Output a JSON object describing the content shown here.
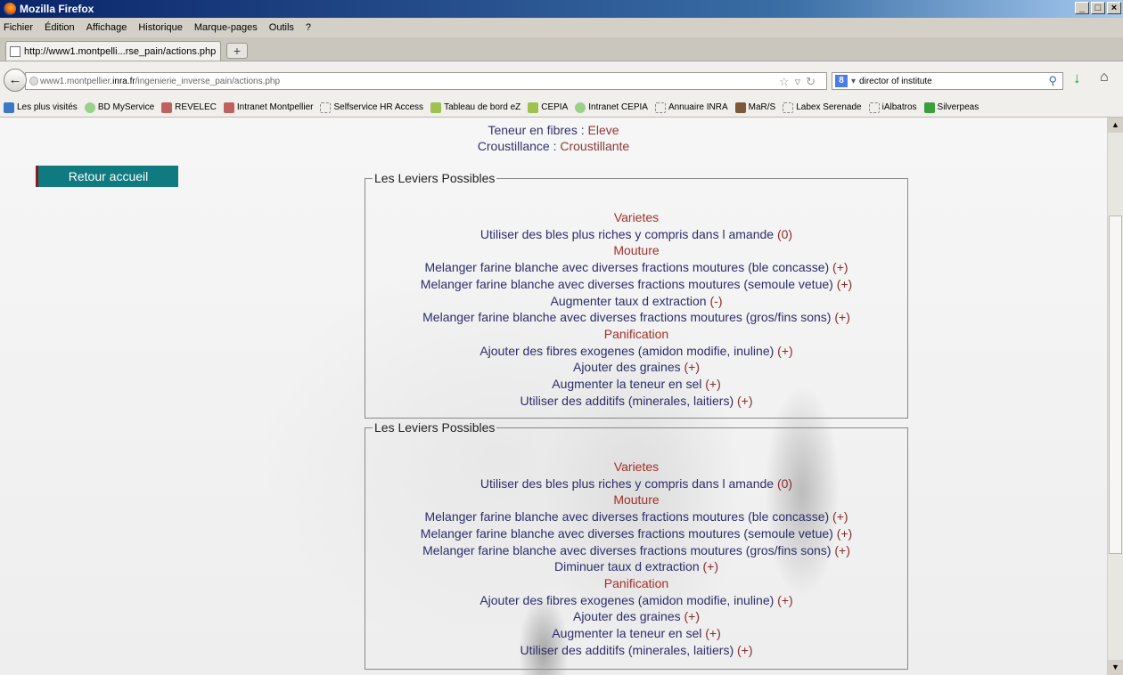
{
  "window": {
    "title": "Mozilla Firefox"
  },
  "menu": [
    "Fichier",
    "Édition",
    "Affichage",
    "Historique",
    "Marque-pages",
    "Outils",
    "?"
  ],
  "tab": {
    "label": "http://www1.montpelli...rse_pain/actions.php",
    "new_tab": "+"
  },
  "nav": {
    "url_pre": "www1.montpellier.",
    "url_domain": "inra.fr",
    "url_post": "/ingenierie_inverse_pain/actions.php",
    "search_value": "director of institute",
    "search_engine": "8"
  },
  "bookmarks": [
    "Les plus visités",
    "BD MyService",
    "REVELEC",
    "Intranet Montpellier",
    "Selfservice HR Access",
    "Tableau de bord eZ",
    "CEPIA",
    "Intranet CEPIA",
    "Annuaire INRA",
    "MaR/S",
    "Labex Serenade",
    "iAlbatros",
    "Silverpeas"
  ],
  "page": {
    "fibres_label": "Teneur en fibres : ",
    "fibres_value": "Eleve",
    "crous_label": "Croustillance : ",
    "crous_value": "Croustillante",
    "retour": "Retour accueil",
    "legend": "Les Leviers Possibles"
  },
  "boxes": [
    [
      {
        "t": "cat",
        "text": "Varietes"
      },
      {
        "t": "act",
        "text": "Utiliser des bles plus riches y compris dans l amande",
        "sign": "(0)"
      },
      {
        "t": "cat",
        "text": "Mouture"
      },
      {
        "t": "act",
        "text": "Melanger farine blanche avec diverses fractions moutures (ble concasse)",
        "sign": "(+)"
      },
      {
        "t": "act",
        "text": "Melanger farine blanche avec diverses fractions moutures (semoule vetue)",
        "sign": "(+)"
      },
      {
        "t": "act",
        "text": "Augmenter taux d extraction",
        "sign": "(-)"
      },
      {
        "t": "act",
        "text": "Melanger farine blanche avec diverses fractions moutures (gros/fins sons)",
        "sign": "(+)"
      },
      {
        "t": "cat",
        "text": "Panification"
      },
      {
        "t": "act",
        "text": "Ajouter des fibres exogenes (amidon modifie, inuline)",
        "sign": "(+)"
      },
      {
        "t": "act",
        "text": "Ajouter des graines",
        "sign": "(+)"
      },
      {
        "t": "act",
        "text": "Augmenter la teneur en sel",
        "sign": "(+)"
      },
      {
        "t": "act",
        "text": "Utiliser des additifs (minerales, laitiers)",
        "sign": "(+)"
      }
    ],
    [
      {
        "t": "cat",
        "text": "Varietes"
      },
      {
        "t": "act",
        "text": "Utiliser des bles plus riches y compris dans l amande",
        "sign": "(0)"
      },
      {
        "t": "cat",
        "text": "Mouture"
      },
      {
        "t": "act",
        "text": "Melanger farine blanche avec diverses fractions moutures (ble concasse)",
        "sign": "(+)"
      },
      {
        "t": "act",
        "text": "Melanger farine blanche avec diverses fractions moutures (semoule vetue)",
        "sign": "(+)"
      },
      {
        "t": "act",
        "text": "Melanger farine blanche avec diverses fractions moutures (gros/fins sons)",
        "sign": "(+)"
      },
      {
        "t": "act",
        "text": "Diminuer taux d extraction",
        "sign": "(+)"
      },
      {
        "t": "cat",
        "text": "Panification"
      },
      {
        "t": "act",
        "text": "Ajouter des fibres exogenes (amidon modifie, inuline)",
        "sign": "(+)"
      },
      {
        "t": "act",
        "text": "Ajouter des graines",
        "sign": "(+)"
      },
      {
        "t": "act",
        "text": "Augmenter la teneur en sel",
        "sign": "(+)"
      },
      {
        "t": "act",
        "text": "Utiliser des additifs (minerales, laitiers)",
        "sign": "(+)"
      }
    ]
  ]
}
